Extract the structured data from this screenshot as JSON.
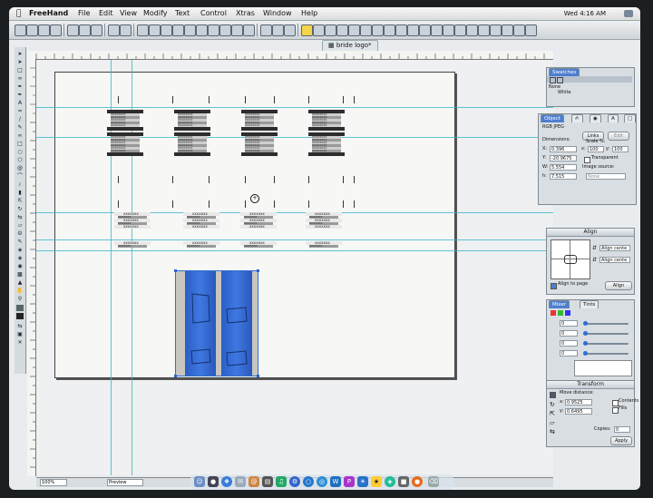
{
  "menubar": {
    "app_name": "FreeHand",
    "items": [
      "File",
      "Edit",
      "View",
      "Modify",
      "Text",
      "Control",
      "Xtras",
      "Window",
      "Help"
    ],
    "clock": "Wed 4:16 AM"
  },
  "document": {
    "title": "bride logo*"
  },
  "swatches": {
    "title": "Swatches",
    "items": [
      "None",
      "White"
    ]
  },
  "object_panel": {
    "tab_label": "Object",
    "type": "RGB JPEG",
    "dimensions_label": "Dimensions:",
    "links_button": "Links",
    "edit_button": "Edit",
    "scale_label": "Scale %:",
    "scale_x": "100",
    "scale_y": "100",
    "x_label": "X:",
    "x_value": "0.396",
    "y_label": "Y:",
    "y_value": "-20.9675",
    "w_label": "W:",
    "w_value": "5.554",
    "h_label": "h:",
    "h_value": "7.515",
    "transparent_label": "Transparent",
    "image_source_label": "Image source:",
    "image_source_value": "None"
  },
  "align_panel": {
    "title": "Align",
    "h_select": "Align cente",
    "v_select": "Align cente",
    "align_to_page_label": "Align to page",
    "align_button": "Align"
  },
  "mixer_panel": {
    "tab_mixer": "Mixer",
    "tab_tints": "Tints",
    "values": [
      "0",
      "0",
      "0",
      "0"
    ]
  },
  "transform_panel": {
    "title": "Transform",
    "move_distance_label": "Move distance:",
    "x_label": "x:",
    "x_value": "0.9525",
    "y_label": "y:",
    "y_value": "0.6495",
    "contents_label": "Contents",
    "fills_label": "Fills",
    "copies_label": "Copies:",
    "copies_value": "0",
    "apply_button": "Apply"
  },
  "status": {
    "zoom": "100%",
    "view_mode": "Preview"
  },
  "cards": {
    "rows_top": [
      "XXXXXXXX",
      "XXXXXXXX",
      "XXXXXXXX",
      "XXXXXXXX",
      "XXXXXXXX"
    ],
    "rows_bottom": [
      "XXXXXXX",
      "XXXXXXX",
      "XXXXXXX"
    ]
  }
}
